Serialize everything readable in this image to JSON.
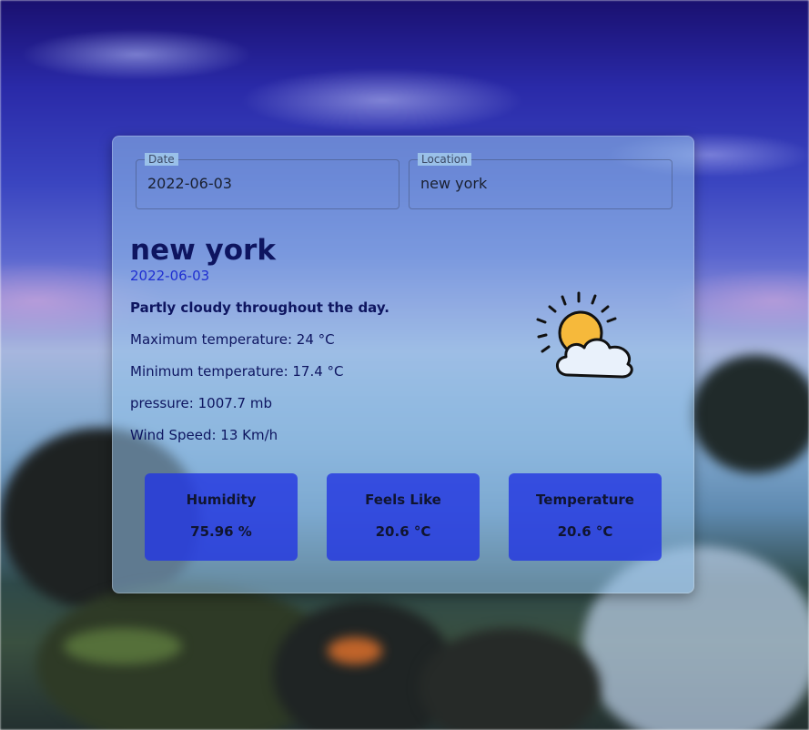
{
  "form": {
    "date": {
      "label": "Date",
      "value": "2022-06-03"
    },
    "location": {
      "label": "Location",
      "value": "new york"
    }
  },
  "weather": {
    "city": "new york",
    "date": "2022-06-03",
    "description": "Partly cloudy throughout the day.",
    "details": {
      "max_temp": "Maximum temperature: 24 °C",
      "min_temp": "Minimum temperature: 17.4 °C",
      "pressure": "pressure: 1007.7 mb",
      "wind": "Wind Speed: 13 Km/h"
    },
    "icon": "partly-cloudy-day-icon"
  },
  "stats": [
    {
      "title": "Humidity",
      "value": "75.96 %"
    },
    {
      "title": "Feels Like",
      "value": "20.6 °C"
    },
    {
      "title": "Temperature",
      "value": "20.6 °C"
    }
  ],
  "colors": {
    "primary_text": "#0e1560",
    "date_text": "#1f2fd1",
    "stat_box": "#2337e1"
  }
}
